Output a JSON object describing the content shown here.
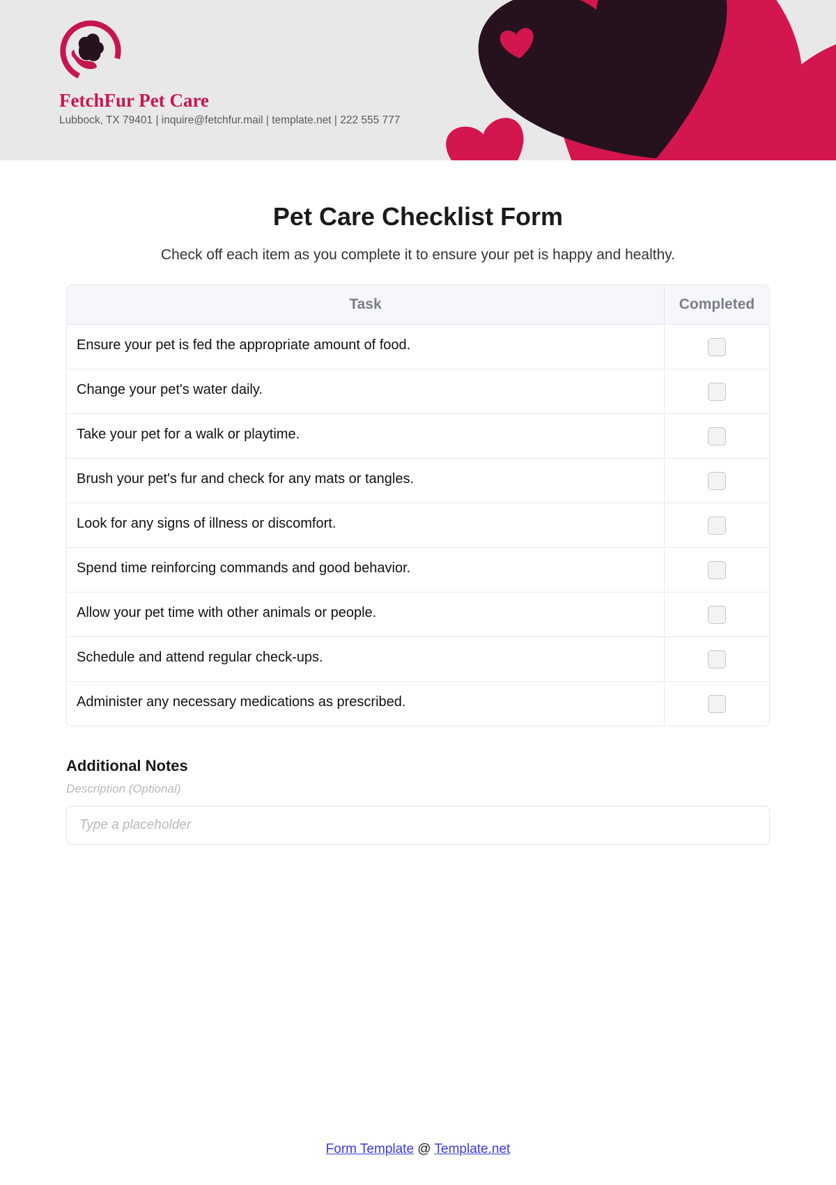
{
  "header": {
    "brand": "FetchFur Pet Care",
    "contact": "Lubbock, TX 79401 | inquire@fetchfur.mail | template.net | 222 555 777"
  },
  "main": {
    "title": "Pet Care Checklist Form",
    "intro": "Check off each item as you complete it to ensure your pet is happy and healthy.",
    "table": {
      "header_task": "Task",
      "header_completed": "Completed",
      "rows": [
        {
          "task": "Ensure your pet is fed the appropriate amount of food."
        },
        {
          "task": "Change your pet's water daily."
        },
        {
          "task": "Take your pet for a walk or playtime."
        },
        {
          "task": "Brush your pet's fur and check for any mats or tangles."
        },
        {
          "task": "Look for any signs of illness or discomfort."
        },
        {
          "task": "Spend time reinforcing commands and good behavior."
        },
        {
          "task": "Allow your pet time with other animals or people."
        },
        {
          "task": "Schedule and attend regular check-ups."
        },
        {
          "task": "Administer any necessary medications as prescribed."
        }
      ]
    },
    "notes": {
      "title": "Additional Notes",
      "desc": "Description (Optional)",
      "placeholder": "Type a placeholder"
    }
  },
  "footer": {
    "link1": "Form Template",
    "sep": " @ ",
    "link2": "Template.net"
  },
  "colors": {
    "accent": "#c5174d",
    "dark": "#25121e"
  }
}
